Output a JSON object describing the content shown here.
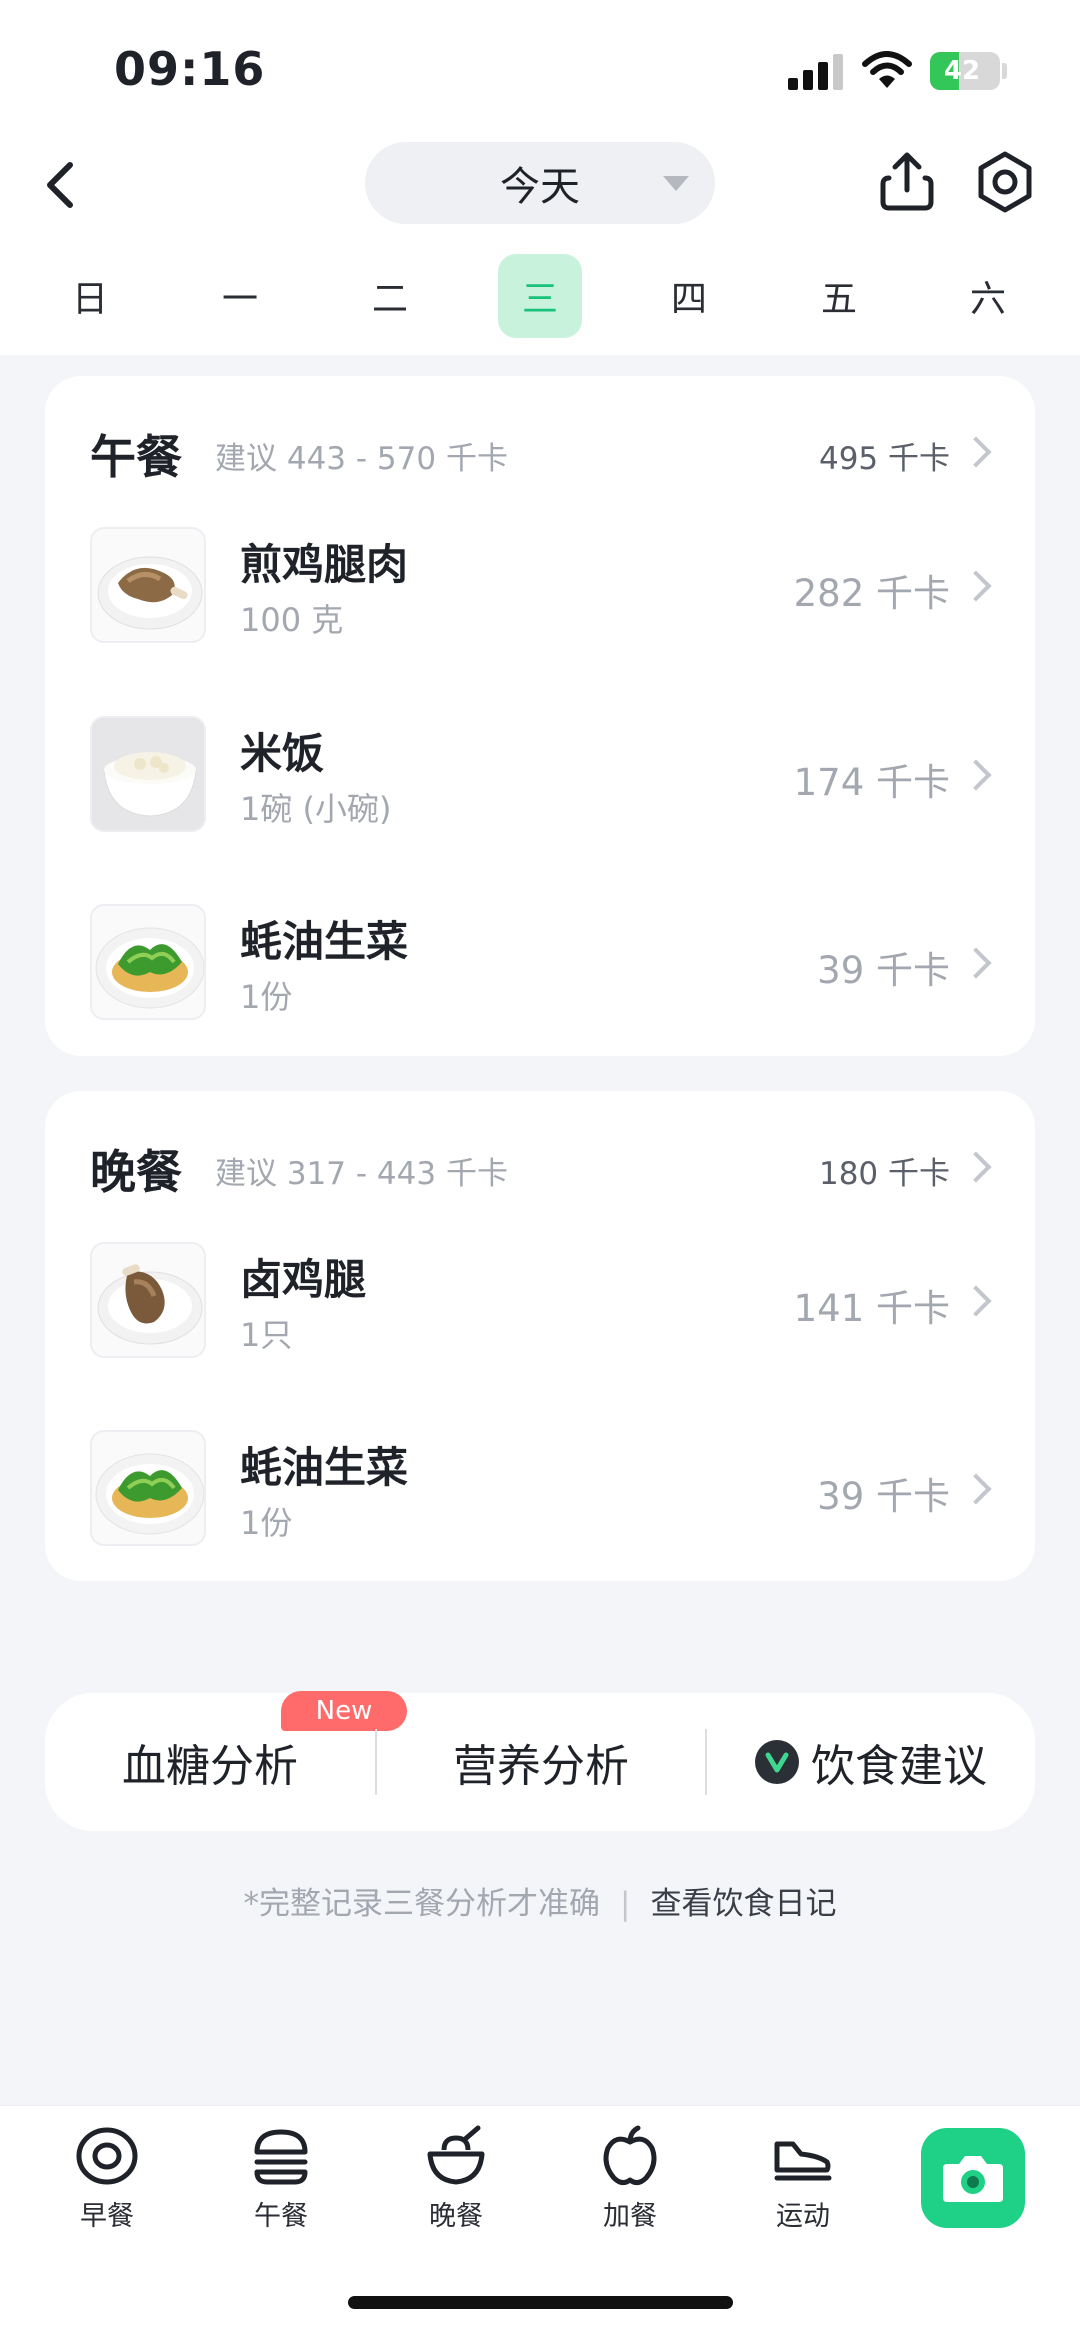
{
  "status_bar": {
    "time": "09:16",
    "battery": "42",
    "battery_level": 0.42
  },
  "header": {
    "date_selector": "今天"
  },
  "week": {
    "days": [
      "日",
      "一",
      "二",
      "三",
      "四",
      "五",
      "六"
    ],
    "active_index": 3
  },
  "meals": [
    {
      "name": "午餐",
      "suggestion": "建议 443 - 570 千卡",
      "total": "495 千卡",
      "items": [
        {
          "name": "煎鸡腿肉",
          "amount": "100 克",
          "kcal": "282 千卡",
          "image": "fried-chicken-leg"
        },
        {
          "name": "米饭",
          "amount": "1碗 (小碗)",
          "kcal": "174 千卡",
          "image": "rice-bowl"
        },
        {
          "name": "蚝油生菜",
          "amount": "1份",
          "kcal": "39 千卡",
          "image": "oyster-sauce-lettuce"
        }
      ]
    },
    {
      "name": "晚餐",
      "suggestion": "建议 317 - 443 千卡",
      "total": "180 千卡",
      "items": [
        {
          "name": "卤鸡腿",
          "amount": "1只",
          "kcal": "141 千卡",
          "image": "braised-chicken-leg"
        },
        {
          "name": "蚝油生菜",
          "amount": "1份",
          "kcal": "39 千卡",
          "image": "oyster-sauce-lettuce"
        }
      ]
    }
  ],
  "analysis": {
    "badge": "New",
    "blood_sugar": "血糖分析",
    "nutrition": "营养分析",
    "diet_advice": "饮食建议"
  },
  "footnote": {
    "note": "*完整记录三餐分析才准确",
    "link": "查看饮食日记"
  },
  "tabbar": {
    "breakfast": "早餐",
    "lunch": "午餐",
    "dinner": "晚餐",
    "snack": "加餐",
    "exercise": "运动"
  },
  "colors": {
    "accent": "#1fd186",
    "active_day_bg": "#c9f2dd",
    "badge": "#ff6b6b"
  }
}
